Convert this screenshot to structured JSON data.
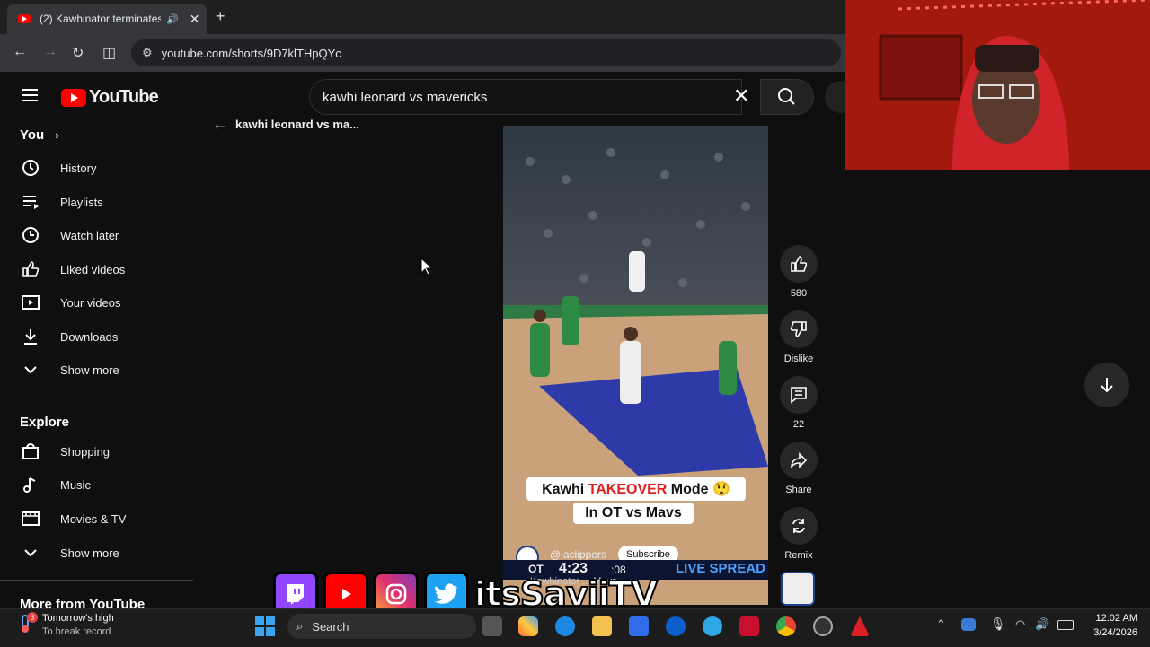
{
  "browser": {
    "tab_title": "(2) Kawhinator terminates the",
    "url": "youtube.com/shorts/9D7klTHpQYc"
  },
  "youtube": {
    "logo_text": "YouTube",
    "search_value": "kawhi leonard vs mavericks"
  },
  "sidebar": {
    "you_label": "You",
    "you_items": [
      {
        "label": "History",
        "icon": "history-icon"
      },
      {
        "label": "Playlists",
        "icon": "playlists-icon"
      },
      {
        "label": "Watch later",
        "icon": "watch-later-icon"
      },
      {
        "label": "Liked videos",
        "icon": "liked-icon"
      },
      {
        "label": "Your videos",
        "icon": "your-videos-icon"
      },
      {
        "label": "Downloads",
        "icon": "download-icon"
      },
      {
        "label": "Show more",
        "icon": "chevron-down-icon"
      }
    ],
    "explore_label": "Explore",
    "explore_items": [
      {
        "label": "Shopping",
        "icon": "shopping-icon"
      },
      {
        "label": "Music",
        "icon": "music-icon"
      },
      {
        "label": "Movies & TV",
        "icon": "movies-icon"
      },
      {
        "label": "Show more",
        "icon": "chevron-down-icon"
      }
    ],
    "more_label": "More from YouTube"
  },
  "shorts": {
    "back_label": "kawhi leonard vs ma...",
    "caption_line1_pre": "Kawhi ",
    "caption_line1_hl": "TAKEOVER",
    "caption_line1_post": " Mode 😲",
    "caption_line2": "In OT vs Mavs",
    "channel": "@laclippers",
    "subscribe_label": "Subscribe",
    "score_period": "OT",
    "score_clock": "4:23",
    "score_shot": ":08",
    "score_banner": "LIVE SPREAD",
    "video_title_partial": "Kawhinator ... Mavs",
    "like_count": "580",
    "dislike_label": "Dislike",
    "comment_count": "22",
    "share_label": "Share",
    "remix_label": "Remix"
  },
  "overlay": {
    "banner_text": "itsSaviiTV",
    "icons": [
      "twitch-icon",
      "youtube-icon",
      "instagram-icon",
      "twitter-icon"
    ]
  },
  "taskbar": {
    "weather_title": "Tomorrow's high",
    "weather_sub": "To break record",
    "weather_badge": "3",
    "search_label": "Search",
    "time": "12:02 AM",
    "date": "3/24/2026"
  },
  "colors": {
    "yt_red": "#ff0000",
    "background": "#0f0f0f",
    "highlight": "#e0201e"
  }
}
